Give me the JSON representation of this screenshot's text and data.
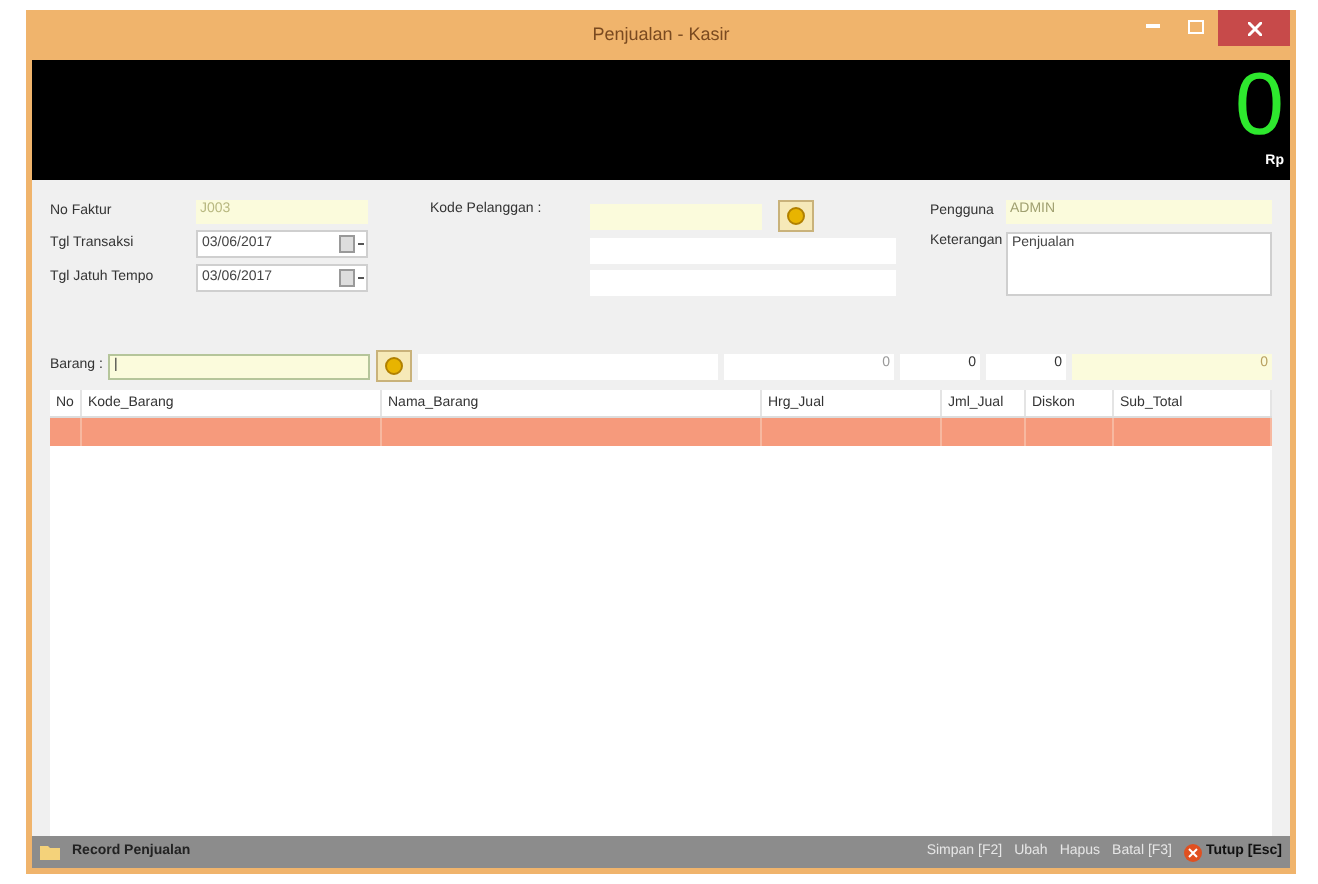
{
  "window": {
    "title": "Penjualan - Kasir"
  },
  "display": {
    "total": "0",
    "unit": "Rp"
  },
  "form": {
    "no_faktur": {
      "label": "No Faktur",
      "value": "J003"
    },
    "tgl_transaksi": {
      "label": "Tgl Transaksi",
      "value": "03/06/2017"
    },
    "tgl_jatuh_tempo": {
      "label": "Tgl Jatuh Tempo",
      "value": "03/06/2017"
    },
    "kode_pelanggan": {
      "label": "Kode Pelanggan :"
    },
    "pengguna": {
      "label": "Pengguna",
      "value": "ADMIN"
    },
    "keterangan": {
      "label": "Keterangan",
      "value": "Penjualan"
    }
  },
  "barang": {
    "label": "Barang :",
    "value": "|",
    "harga": "0",
    "jumlah": "0",
    "diskon": "0",
    "subtotal": "0"
  },
  "table": {
    "columns": [
      "No",
      "Kode_Barang",
      "Nama_Barang",
      "Hrg_Jual",
      "Jml_Jual",
      "Diskon",
      "Sub_Total"
    ]
  },
  "status_bar": {
    "title": "Record Penjualan",
    "buttons": [
      {
        "label": "Simpan [F2]",
        "disabled": true
      },
      {
        "label": "Ubah",
        "disabled": true
      },
      {
        "label": "Hapus",
        "disabled": true
      },
      {
        "label": "Batal [F3]",
        "disabled": true
      },
      {
        "label": "Tutup [Esc]",
        "disabled": false
      }
    ]
  }
}
